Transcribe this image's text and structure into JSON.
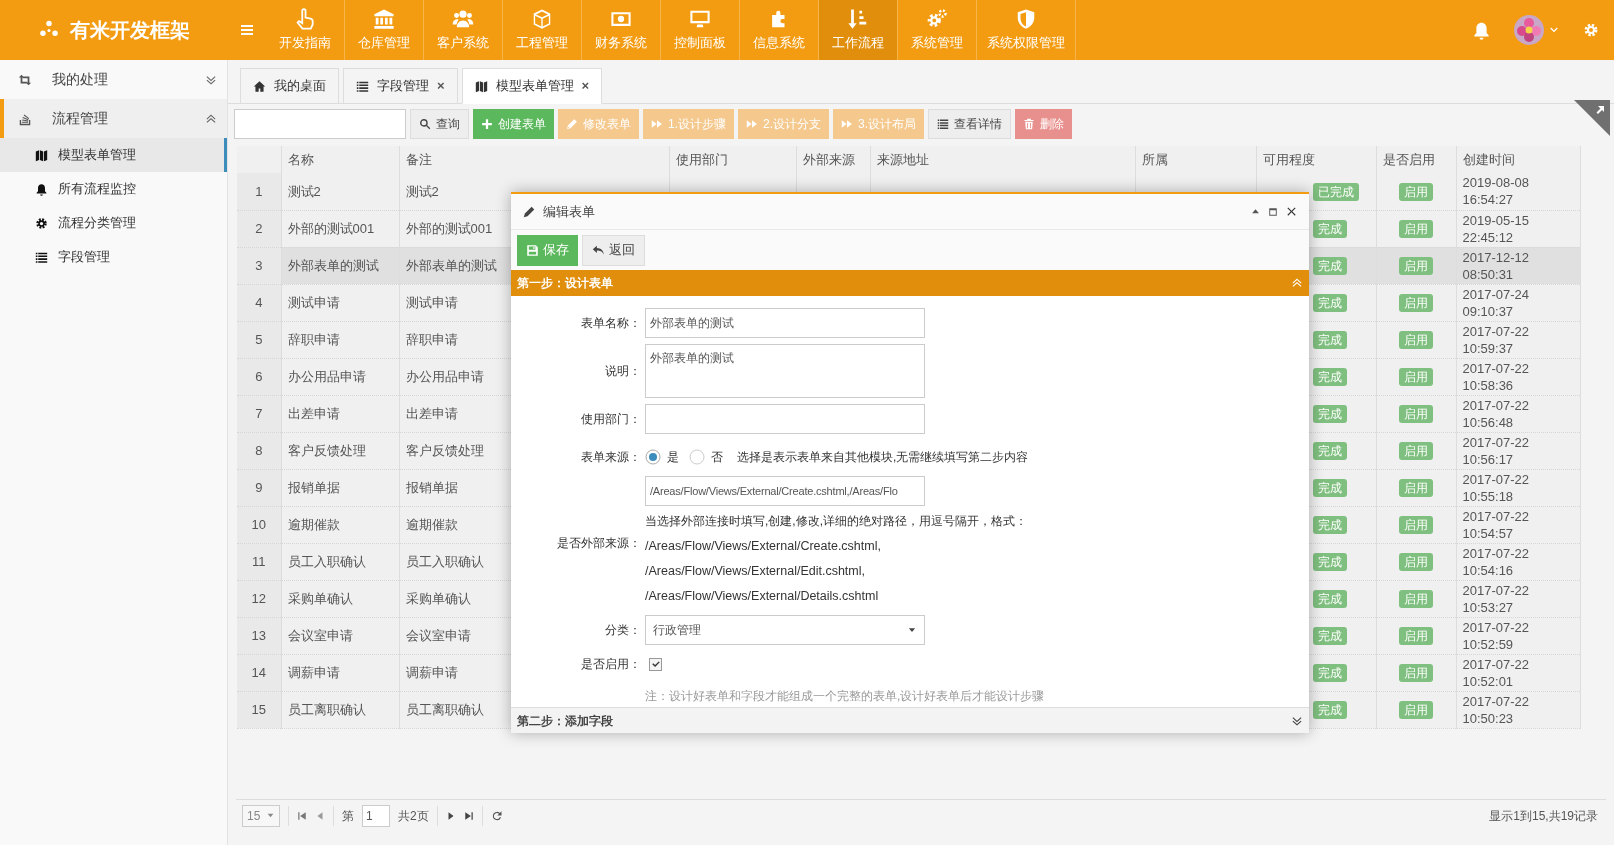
{
  "header": {
    "logo": "有米开发框架"
  },
  "nav": [
    {
      "label": "开发指南",
      "selected": false
    },
    {
      "label": "仓库管理",
      "selected": false
    },
    {
      "label": "客户系统",
      "selected": false
    },
    {
      "label": "工程管理",
      "selected": false
    },
    {
      "label": "财务系统",
      "selected": false
    },
    {
      "label": "控制面板",
      "selected": false
    },
    {
      "label": "信息系统",
      "selected": false
    },
    {
      "label": "工作流程",
      "selected": true
    },
    {
      "label": "系统管理",
      "selected": false
    },
    {
      "label": "系统权限管理",
      "selected": false
    }
  ],
  "sidebar": {
    "items": [
      {
        "label": "我的处理",
        "expanded": false,
        "selected": false
      },
      {
        "label": "流程管理",
        "expanded": true,
        "selected": true,
        "children": [
          {
            "label": "模型表单管理",
            "selected": true
          },
          {
            "label": "所有流程监控",
            "selected": false
          },
          {
            "label": "流程分类管理",
            "selected": false
          },
          {
            "label": "字段管理",
            "selected": false
          }
        ]
      }
    ]
  },
  "tabs": [
    {
      "label": "我的桌面",
      "selected": false
    },
    {
      "label": "字段管理",
      "selected": false,
      "close": "×"
    },
    {
      "label": "模型表单管理",
      "selected": true,
      "close": "×"
    }
  ],
  "toolbar": {
    "buttons": [
      {
        "label": "查询",
        "kind": "plain",
        "disabled": false
      },
      {
        "label": "创建表单",
        "kind": "success",
        "disabled": false
      },
      {
        "label": "修改表单",
        "kind": "warning",
        "disabled": true
      },
      {
        "label": "1.设计步骤",
        "kind": "warning",
        "disabled": true
      },
      {
        "label": "2.设计分支",
        "kind": "warning",
        "disabled": true
      },
      {
        "label": "3.设计布局",
        "kind": "warning",
        "disabled": true
      },
      {
        "label": "查看详情",
        "kind": "plain",
        "disabled": false
      },
      {
        "label": "删除",
        "kind": "danger",
        "disabled": true
      }
    ]
  },
  "table": {
    "columns": [
      "名称",
      "备注",
      "使用部门",
      "外部来源",
      "来源地址",
      "所属",
      "可用程度",
      "是否启用",
      "创建时间"
    ],
    "rows": [
      {
        "number": "1",
        "name": "测试2",
        "remark": "测试2",
        "availability": "已完成",
        "enabled": "启用",
        "created": "2019-08-08 16:54:27",
        "selected": false
      },
      {
        "number": "2",
        "name": "外部的测试001",
        "remark": "外部的测试001",
        "availability": "完成",
        "enabled": "启用",
        "created": "2019-05-15 22:45:12",
        "selected": false
      },
      {
        "number": "3",
        "name": "外部表单的测试",
        "remark": "外部表单的测试",
        "availability": "完成",
        "enabled": "启用",
        "created": "2017-12-12 08:50:31",
        "selected": true
      },
      {
        "number": "4",
        "name": "测试申请",
        "remark": "测试申请",
        "availability": "完成",
        "enabled": "启用",
        "created": "2017-07-24 09:10:37",
        "selected": false
      },
      {
        "number": "5",
        "name": "辞职申请",
        "remark": "辞职申请",
        "availability": "完成",
        "enabled": "启用",
        "created": "2017-07-22 10:59:37",
        "selected": false
      },
      {
        "number": "6",
        "name": "办公用品申请",
        "remark": "办公用品申请",
        "availability": "完成",
        "enabled": "启用",
        "created": "2017-07-22 10:58:36",
        "selected": false
      },
      {
        "number": "7",
        "name": "出差申请",
        "remark": "出差申请",
        "availability": "完成",
        "enabled": "启用",
        "created": "2017-07-22 10:56:48",
        "selected": false
      },
      {
        "number": "8",
        "name": "客户反馈处理",
        "remark": "客户反馈处理",
        "availability": "完成",
        "enabled": "启用",
        "created": "2017-07-22 10:56:17",
        "selected": false
      },
      {
        "number": "9",
        "name": "报销单据",
        "remark": "报销单据",
        "availability": "完成",
        "enabled": "启用",
        "created": "2017-07-22 10:55:18",
        "selected": false
      },
      {
        "number": "10",
        "name": "逾期催款",
        "remark": "逾期催款",
        "availability": "完成",
        "enabled": "启用",
        "created": "2017-07-22 10:54:57",
        "selected": false
      },
      {
        "number": "11",
        "name": "员工入职确认",
        "remark": "员工入职确认",
        "availability": "完成",
        "enabled": "启用",
        "created": "2017-07-22 10:54:16",
        "selected": false
      },
      {
        "number": "12",
        "name": "采购单确认",
        "remark": "采购单确认",
        "availability": "完成",
        "enabled": "启用",
        "created": "2017-07-22 10:53:27",
        "selected": false
      },
      {
        "number": "13",
        "name": "会议室申请",
        "remark": "会议室申请",
        "availability": "完成",
        "enabled": "启用",
        "created": "2017-07-22 10:52:59",
        "selected": false
      },
      {
        "number": "14",
        "name": "调薪申请",
        "remark": "调薪申请",
        "availability": "完成",
        "enabled": "启用",
        "created": "2017-07-22 10:52:01",
        "selected": false
      },
      {
        "number": "15",
        "name": "员工离职确认",
        "remark": "员工离职确认",
        "availability": "完成",
        "enabled": "启用",
        "created": "2017-07-22 10:50:23",
        "selected": false
      }
    ]
  },
  "pager": {
    "page_size": "15",
    "page_prefix": "第",
    "page": "1",
    "page_suffix": "共2页",
    "summary": "显示1到15,共19记录"
  },
  "modal": {
    "title": "编辑表单",
    "buttons": [
      {
        "label": "保存",
        "kind": "success"
      },
      {
        "label": "返回",
        "kind": "plain"
      }
    ],
    "sections": [
      {
        "title": "第一步：设计表单",
        "expanded": true
      },
      {
        "title": "第二步：添加字段",
        "expanded": false
      }
    ],
    "form": [
      {
        "kind": "text",
        "label": "表单名称：",
        "value": "外部表单的测试"
      },
      {
        "kind": "textarea",
        "label": "说明：",
        "value": "外部表单的测试"
      },
      {
        "kind": "text",
        "label": "使用部门："
      },
      {
        "kind": "radio",
        "label": "表单来源：",
        "options": [
          {
            "label": "是",
            "selected": true
          },
          {
            "label": "否",
            "selected": false
          }
        ],
        "hint": "选择是表示表单来自其他模块,无需继续填写第二步内容"
      },
      {
        "kind": "text",
        "value": "/Areas/Flow/Views/External/Create.cshtml,/Areas/Flo"
      },
      {
        "kind": "help",
        "text": "当选择外部连接时填写,创建,修改,详细的绝对路径，用逗号隔开，格式："
      },
      {
        "kind": "paths",
        "label": "是否外部来源：",
        "lines": [
          "/Areas/Flow/Views/External/Create.cshtml,",
          "/Areas/Flow/Views/External/Edit.cshtml,",
          "/Areas/Flow/Views/External/Details.cshtml"
        ]
      },
      {
        "kind": "select",
        "label": "分类：",
        "value": "行政管理"
      },
      {
        "kind": "checkbox",
        "label": "是否启用：",
        "checked": true
      },
      {
        "kind": "note",
        "text": "注：设计好表单和字段才能组成一个完整的表单,设计好表单后才能设计步骤"
      }
    ]
  }
}
